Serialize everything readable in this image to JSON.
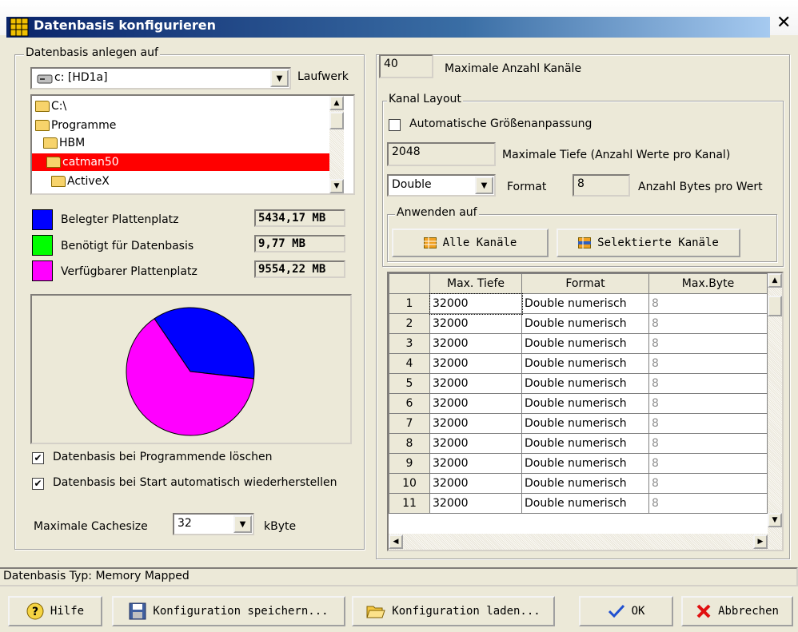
{
  "window": {
    "title": "Datenbasis konfigurieren",
    "close_glyph": "✕"
  },
  "left": {
    "group_label": "Datenbasis anlegen auf",
    "drive": {
      "value": "c: [HD1a]",
      "label": "Laufwerk"
    },
    "tree": [
      {
        "label": "C:\\",
        "selected": false
      },
      {
        "label": "Programme",
        "selected": false
      },
      {
        "label": "HBM",
        "selected": false
      },
      {
        "label": "catman50",
        "selected": true
      },
      {
        "label": "ActiveX",
        "selected": false
      }
    ],
    "legend": [
      {
        "label": "Belegter Plattenplatz",
        "value": "5434,17 MB",
        "color": "#0000ff"
      },
      {
        "label": "Benötigt für Datenbasis",
        "value": "9,77 MB",
        "color": "#00ff00"
      },
      {
        "label": "Verfügbarer Plattenplatz",
        "value": "9554,22 MB",
        "color": "#ff00ff"
      }
    ],
    "checkboxes": [
      {
        "label": "Datenbasis bei Programmende löschen",
        "checked": true
      },
      {
        "label": "Datenbasis bei Start automatisch wiederherstellen",
        "checked": true
      }
    ],
    "cache": {
      "label": "Maximale Cachesize",
      "value": "32",
      "unit": "kByte"
    }
  },
  "chart_data": {
    "type": "pie",
    "title": "",
    "slices": [
      {
        "name": "Belegter Plattenplatz",
        "value": 5434.17,
        "color": "#0000ff"
      },
      {
        "name": "Benötigt für Datenbasis",
        "value": 9.77,
        "color": "#00ff00"
      },
      {
        "name": "Verfügbarer Plattenplatz",
        "value": 9554.22,
        "color": "#ff00ff"
      }
    ]
  },
  "right": {
    "max_channels": {
      "value": "40",
      "label": "Maximale Anzahl Kanäle"
    },
    "kanal_layout_label": "Kanal Layout",
    "auto_size": {
      "label": "Automatische Größenanpassung",
      "checked": false
    },
    "max_depth": {
      "value": "2048",
      "label": "Maximale Tiefe (Anzahl Werte pro Kanal)"
    },
    "format": {
      "value": "Double",
      "label": "Format"
    },
    "bytes": {
      "value": "8",
      "label": "Anzahl Bytes pro Wert"
    },
    "apply_label": "Anwenden auf",
    "btn_all": "Alle Kanäle",
    "btn_selected": "Selektierte Kanäle",
    "table": {
      "headers": [
        "",
        "Max. Tiefe",
        "Format",
        "Max.Byte"
      ],
      "rows": [
        [
          "1",
          "32000",
          "Double numerisch",
          "8"
        ],
        [
          "2",
          "32000",
          "Double numerisch",
          "8"
        ],
        [
          "3",
          "32000",
          "Double numerisch",
          "8"
        ],
        [
          "4",
          "32000",
          "Double numerisch",
          "8"
        ],
        [
          "5",
          "32000",
          "Double numerisch",
          "8"
        ],
        [
          "6",
          "32000",
          "Double numerisch",
          "8"
        ],
        [
          "7",
          "32000",
          "Double numerisch",
          "8"
        ],
        [
          "8",
          "32000",
          "Double numerisch",
          "8"
        ],
        [
          "9",
          "32000",
          "Double numerisch",
          "8"
        ],
        [
          "10",
          "32000",
          "Double numerisch",
          "8"
        ],
        [
          "11",
          "32000",
          "Double numerisch",
          "8"
        ]
      ]
    }
  },
  "status": "Datenbasis Typ: Memory Mapped",
  "buttons": {
    "help": "Hilfe",
    "save": "Konfiguration speichern...",
    "load": "Konfiguration laden...",
    "ok": "OK",
    "cancel": "Abbrechen"
  }
}
